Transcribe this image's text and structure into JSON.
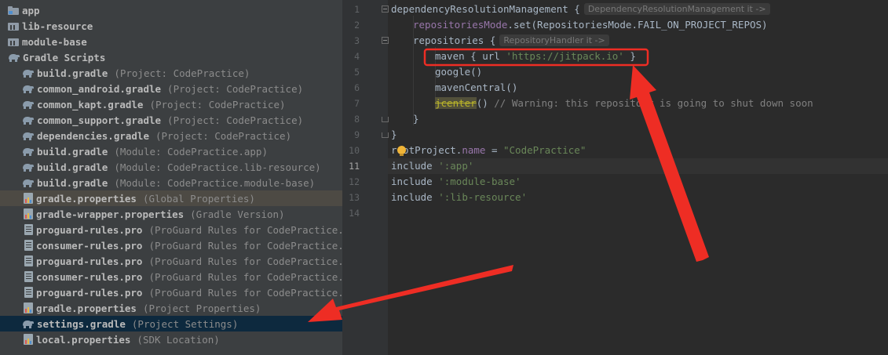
{
  "tree": {
    "items": [
      {
        "name": "app",
        "hint": "",
        "icon": "folder-icon"
      },
      {
        "name": "lib-resource",
        "hint": "",
        "icon": "library-icon"
      },
      {
        "name": "module-base",
        "hint": "",
        "icon": "library-icon"
      },
      {
        "name": "Gradle Scripts",
        "hint": "",
        "icon": "gradle-icon"
      },
      {
        "name": "build.gradle",
        "hint": "(Project: CodePractice)",
        "icon": "gradle-icon"
      },
      {
        "name": "common_android.gradle",
        "hint": "(Project: CodePractice)",
        "icon": "gradle-icon"
      },
      {
        "name": "common_kapt.gradle",
        "hint": "(Project: CodePractice)",
        "icon": "gradle-icon"
      },
      {
        "name": "common_support.gradle",
        "hint": "(Project: CodePractice)",
        "icon": "gradle-icon"
      },
      {
        "name": "dependencies.gradle",
        "hint": "(Project: CodePractice)",
        "icon": "gradle-icon"
      },
      {
        "name": "build.gradle",
        "hint": "(Module: CodePractice.app)",
        "icon": "gradle-icon"
      },
      {
        "name": "build.gradle",
        "hint": "(Module: CodePractice.lib-resource)",
        "icon": "gradle-icon"
      },
      {
        "name": "build.gradle",
        "hint": "(Module: CodePractice.module-base)",
        "icon": "gradle-icon"
      },
      {
        "name": "gradle.properties",
        "hint": "(Global Properties)",
        "icon": "properties-icon"
      },
      {
        "name": "gradle-wrapper.properties",
        "hint": "(Gradle Version)",
        "icon": "properties-icon"
      },
      {
        "name": "proguard-rules.pro",
        "hint": "(ProGuard Rules for CodePractice.app)",
        "icon": "text-file-icon"
      },
      {
        "name": "consumer-rules.pro",
        "hint": "(ProGuard Rules for CodePractice.lib-",
        "icon": "text-file-icon"
      },
      {
        "name": "proguard-rules.pro",
        "hint": "(ProGuard Rules for CodePractice.lib-",
        "icon": "text-file-icon"
      },
      {
        "name": "consumer-rules.pro",
        "hint": "(ProGuard Rules for CodePractice.modu",
        "icon": "text-file-icon"
      },
      {
        "name": "proguard-rules.pro",
        "hint": "(ProGuard Rules for CodePractice.modu",
        "icon": "text-file-icon"
      },
      {
        "name": "gradle.properties",
        "hint": "(Project Properties)",
        "icon": "properties-icon"
      },
      {
        "name": "settings.gradle",
        "hint": "(Project Settings)",
        "icon": "gradle-icon"
      },
      {
        "name": "local.properties",
        "hint": "(SDK Location)",
        "icon": "properties-icon"
      }
    ]
  },
  "editor": {
    "line_numbers": [
      "1",
      "2",
      "3",
      "4",
      "5",
      "6",
      "7",
      "8",
      "9",
      "10",
      "11",
      "12",
      "13",
      "14"
    ],
    "current_line": "11",
    "lines": {
      "l1": {
        "code": "dependencyResolutionManagement {",
        "hint": "DependencyResolutionManagement it ->"
      },
      "l2": {
        "member": "repositoriesMode",
        "rest": ".set(RepositoriesMode.FAIL_ON_PROJECT_REPOS)"
      },
      "l3": {
        "code": "repositories {",
        "hint": "RepositoryHandler it ->"
      },
      "l4": {
        "pre": "maven { url ",
        "str": "'https://jitpack.io'",
        "post": " }"
      },
      "l5": {
        "code": "google()"
      },
      "l6": {
        "code": "mavenCentral()"
      },
      "l7": {
        "deprecated": "jcenter",
        "paren": "()",
        "comment": " // Warning: this repository is going to shut down soon"
      },
      "l8": {
        "code": "}"
      },
      "l9": {
        "code": "}"
      },
      "l10": {
        "pre": "rootProject.",
        "member": "name",
        "mid": " = ",
        "str": "\"CodePractice\""
      },
      "l11": {
        "pre": "include ",
        "str": "':app'"
      },
      "l12": {
        "pre": "include ",
        "str": "':module-base'"
      },
      "l13": {
        "pre": "include ",
        "str": "':lib-resource'"
      }
    }
  },
  "colors": {
    "annotation": "#ee2d24",
    "selection": "#0d293e"
  }
}
